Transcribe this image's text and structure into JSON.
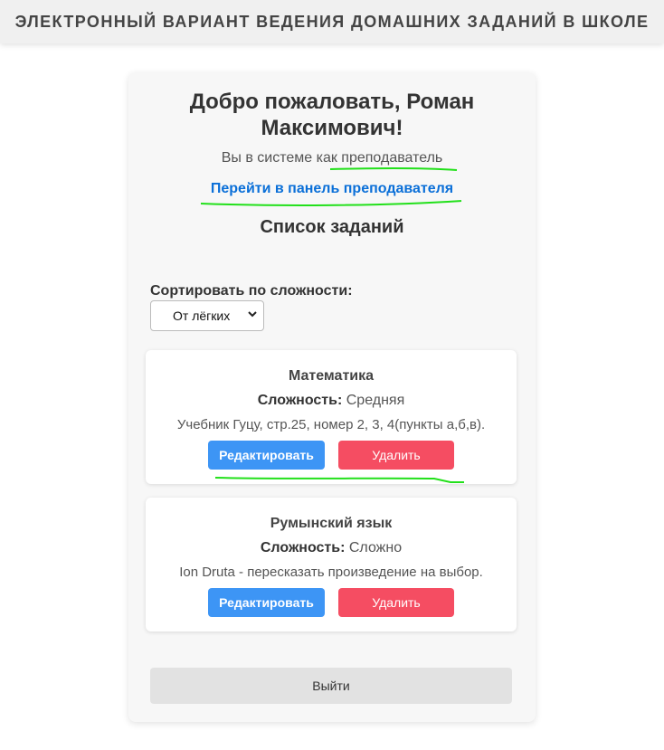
{
  "header": {
    "title": "ЭЛЕКТРОННЫЙ ВАРИАНТ ВЕДЕНИЯ ДОМАШНИХ ЗАДАНИЙ В ШКОЛЕ"
  },
  "welcome": {
    "line1": "Добро пожаловать, Роман",
    "line2": "Максимович!",
    "role_text": "Вы в системе как преподаватель",
    "panel_link": "Перейти в панель преподавателя"
  },
  "tasks_heading": "Список заданий",
  "sort": {
    "label": "Сортировать по сложности:",
    "selected": "От лёгких"
  },
  "difficulty_label": "Сложность:",
  "tasks": [
    {
      "subject": "Математика",
      "difficulty": "Средняя",
      "description": "Учебник Гуцу, стр.25, номер 2, 3, 4(пункты а,б,в).",
      "edit_label": "Редактировать",
      "delete_label": "Удалить"
    },
    {
      "subject": "Румынский язык",
      "difficulty": "Сложно",
      "description": "Ion Druta - пересказать произведение на выбор.",
      "edit_label": "Редактировать",
      "delete_label": "Удалить"
    }
  ],
  "logout_label": "Выйти",
  "colors": {
    "link": "#0a6fd8",
    "edit_button": "#3d95f5",
    "delete_button": "#f54d62",
    "annotation": "#22e01a"
  }
}
